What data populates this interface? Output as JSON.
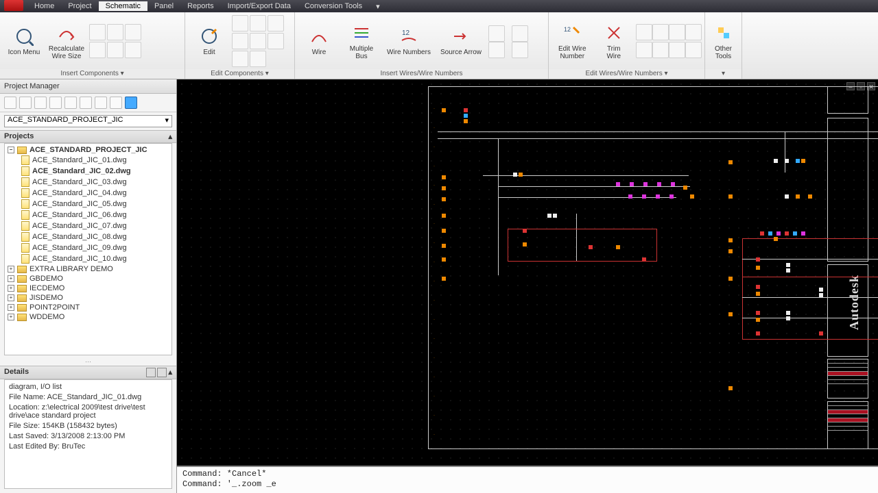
{
  "menu": {
    "tabs": [
      "Home",
      "Project",
      "Schematic",
      "Panel",
      "Reports",
      "Import/Export Data",
      "Conversion Tools"
    ],
    "active": 2
  },
  "ribbon": {
    "groups": [
      {
        "label": "Insert Components ▾",
        "buttons": [
          {
            "label": "Icon Menu"
          },
          {
            "label": "Recalculate\nWire Size"
          }
        ]
      },
      {
        "label": "Edit Components ▾",
        "buttons": [
          {
            "label": "Edit"
          }
        ]
      },
      {
        "label": "Insert Wires/Wire Numbers",
        "buttons": [
          {
            "label": "Wire"
          },
          {
            "label": "Multiple\nBus"
          },
          {
            "label": "Wire Numbers"
          },
          {
            "label": "Source Arrow"
          }
        ]
      },
      {
        "label": "Edit Wires/Wire Numbers ▾",
        "buttons": [
          {
            "label": "Edit Wire\nNumber"
          },
          {
            "label": "Trim\nWire"
          }
        ]
      },
      {
        "label": "▾",
        "buttons": [
          {
            "label": "Other\nTools"
          }
        ]
      }
    ]
  },
  "pm": {
    "title": "Project Manager",
    "project_select": "ACE_STANDARD_PROJECT_JIC",
    "projects_label": "Projects",
    "details_label": "Details",
    "root": "ACE_STANDARD_PROJECT_JIC",
    "files": [
      "ACE_Standard_JIC_01.dwg",
      "ACE_Standard_JIC_02.dwg",
      "ACE_Standard_JIC_03.dwg",
      "ACE_Standard_JIC_04.dwg",
      "ACE_Standard_JIC_05.dwg",
      "ACE_Standard_JIC_06.dwg",
      "ACE_Standard_JIC_07.dwg",
      "ACE_Standard_JIC_08.dwg",
      "ACE_Standard_JIC_09.dwg",
      "ACE_Standard_JIC_10.dwg"
    ],
    "active_file_index": 1,
    "extra": [
      "EXTRA LIBRARY DEMO",
      "GBDEMO",
      "IECDEMO",
      "JISDEMO",
      "POINT2POINT",
      "WDDEMO"
    ],
    "details": {
      "desc": "diagram, I/O list",
      "filename": "File Name: ACE_Standard_JIC_01.dwg",
      "location": "Location: z:\\electrical 2009\\test drive\\test drive\\ace standard project",
      "filesize": "File Size: 154KB (158432 bytes)",
      "saved": "Last Saved: 3/13/2008 2:13:00 PM",
      "edited": "Last Edited By: BruTec"
    }
  },
  "titleblock": {
    "brand": "Autodesk"
  },
  "cmd": {
    "line1": "Command: *Cancel*",
    "line2": "Command: '_.zoom _e"
  }
}
